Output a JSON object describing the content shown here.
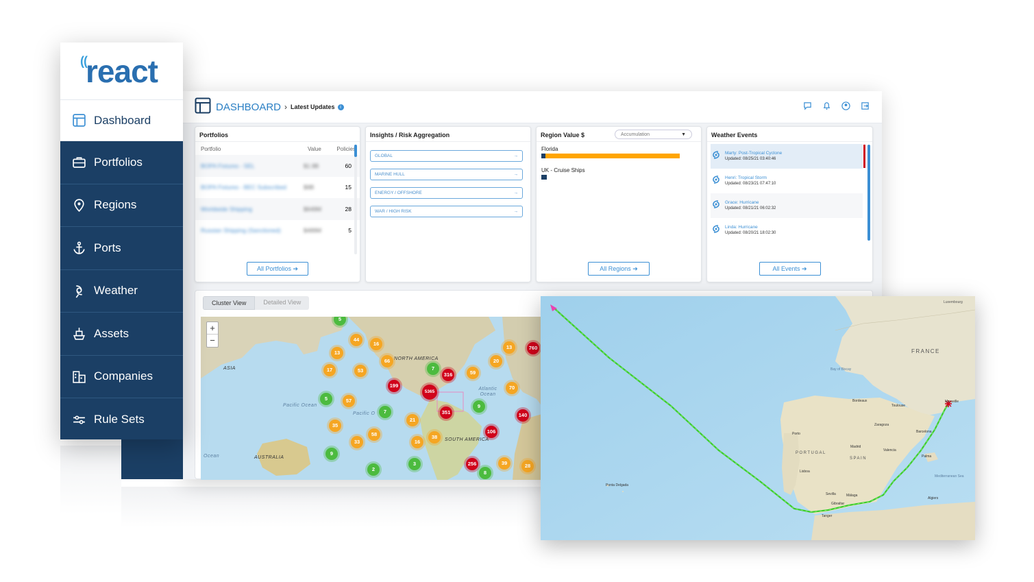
{
  "brand": {
    "logo_text": "react"
  },
  "sidebar": {
    "items": [
      {
        "label": "Dashboard",
        "icon": "dashboard-icon",
        "active": true
      },
      {
        "label": "Portfolios",
        "icon": "briefcase-icon"
      },
      {
        "label": "Regions",
        "icon": "map-pin-icon"
      },
      {
        "label": "Ports",
        "icon": "anchor-icon"
      },
      {
        "label": "Weather",
        "icon": "hurricane-icon"
      },
      {
        "label": "Assets",
        "icon": "ship-icon"
      },
      {
        "label": "Companies",
        "icon": "building-icon"
      },
      {
        "label": "Rule Sets",
        "icon": "sliders-icon"
      }
    ]
  },
  "header": {
    "title": "DASHBOARD",
    "separator": "›",
    "breadcrumb": "Latest Updates",
    "info": "i",
    "icons": [
      "chat-icon",
      "bell-icon",
      "user-icon",
      "logout-icon"
    ]
  },
  "portfolios": {
    "title": "Portfolios",
    "col_portfolio": "Portfolio",
    "col_value": "Value",
    "col_policies": "Policies",
    "rows": [
      {
        "name": "BOPA Fixtures - SEL",
        "value": "$1.9B",
        "policies": "60"
      },
      {
        "name": "BOPA Fixtures - BEC Subscribed",
        "value": "$9B",
        "policies": "15"
      },
      {
        "name": "Worldwide Shipping",
        "value": "$649M",
        "policies": "28"
      },
      {
        "name": "Russian Shipping (Sanctioned)",
        "value": "$489M",
        "policies": "5"
      }
    ],
    "button": "All Portfolios ➔"
  },
  "insights": {
    "title": "Insights / Risk Aggregation",
    "items": [
      "GLOBAL",
      "MARINE HULL",
      "ENERGY / OFFSHORE",
      "WAR / HIGH RISK"
    ],
    "arrow": "→"
  },
  "region_value": {
    "title": "Region Value $",
    "dropdown": "Accumulation",
    "bars": [
      {
        "label": "Florida",
        "fraction": 0.98,
        "color": "#ffa500"
      },
      {
        "label": "UK - Cruise Ships",
        "fraction": 0.04,
        "color": "#1b3f65"
      }
    ],
    "button": "All Regions ➔"
  },
  "weather_events": {
    "title": "Weather Events",
    "items": [
      {
        "name": "Marty: Post-Tropical Cyclone",
        "updated": "Updated: 08/25/21 03:40:46"
      },
      {
        "name": "Henri: Tropical Storm",
        "updated": "Updated: 08/23/21 07:47:10"
      },
      {
        "name": "Grace: Hurricane",
        "updated": "Updated: 08/21/21 06:02:32"
      },
      {
        "name": "Linda: Hurricane",
        "updated": "Updated: 08/20/21 18:02:30"
      }
    ],
    "button": "All Events ➔"
  },
  "map": {
    "toggle_cluster": "Cluster View",
    "toggle_detailed": "Detailed View",
    "zoom_in": "+",
    "zoom_out": "−",
    "labels": [
      "ASIA",
      "NORTH AMERICA",
      "Pacific Ocean",
      "Pacific O",
      "Atlantic Ocean",
      "SOUTH AMERICA",
      "AUSTRALIA",
      "Ocean"
    ],
    "clusters": [
      {
        "count": "5",
        "level": "green"
      },
      {
        "count": "44",
        "level": "orange"
      },
      {
        "count": "16",
        "level": "orange"
      },
      {
        "count": "13",
        "level": "orange"
      },
      {
        "count": "13",
        "level": "orange"
      },
      {
        "count": "760",
        "level": "red"
      },
      {
        "count": "66",
        "level": "orange"
      },
      {
        "count": "20",
        "level": "orange"
      },
      {
        "count": "17",
        "level": "orange"
      },
      {
        "count": "53",
        "level": "orange"
      },
      {
        "count": "7",
        "level": "green"
      },
      {
        "count": "316",
        "level": "red"
      },
      {
        "count": "59",
        "level": "orange"
      },
      {
        "count": "199",
        "level": "red"
      },
      {
        "count": "5365",
        "level": "red"
      },
      {
        "count": "70",
        "level": "orange"
      },
      {
        "count": "5",
        "level": "green"
      },
      {
        "count": "57",
        "level": "orange"
      },
      {
        "count": "7",
        "level": "green"
      },
      {
        "count": "351",
        "level": "red"
      },
      {
        "count": "9",
        "level": "green"
      },
      {
        "count": "140",
        "level": "red"
      },
      {
        "count": "21",
        "level": "orange"
      },
      {
        "count": "35",
        "level": "orange"
      },
      {
        "count": "58",
        "level": "orange"
      },
      {
        "count": "106",
        "level": "red"
      },
      {
        "count": "33",
        "level": "orange"
      },
      {
        "count": "38",
        "level": "orange"
      },
      {
        "count": "16",
        "level": "orange"
      },
      {
        "count": "9",
        "level": "green"
      },
      {
        "count": "256",
        "level": "red"
      },
      {
        "count": "39",
        "level": "orange"
      },
      {
        "count": "28",
        "level": "orange"
      },
      {
        "count": "2",
        "level": "green"
      },
      {
        "count": "3",
        "level": "green"
      },
      {
        "count": "8",
        "level": "green"
      }
    ]
  },
  "route_map": {
    "labels": [
      "FRANCE",
      "SPAIN",
      "PORTUGAL",
      "Marseille",
      "Barcelona",
      "Madrid",
      "Lisboa",
      "Valencia",
      "Sevilla",
      "Bay of Biscay",
      "Mediterranean Sea",
      "Ponta Delgada",
      "Algiers",
      "Tanger",
      "Luxembourg",
      "Porto",
      "Palma",
      "Málaga",
      "Bordeaux",
      "Toulouse",
      "Zaragoza",
      "Gibraltar"
    ]
  },
  "colors": {
    "navy": "#1b3f65",
    "accent": "#3b8fd4",
    "orange": "#f5a623",
    "red": "#d0021b",
    "green": "#4cbb3f",
    "route": "#3ccc2c"
  }
}
